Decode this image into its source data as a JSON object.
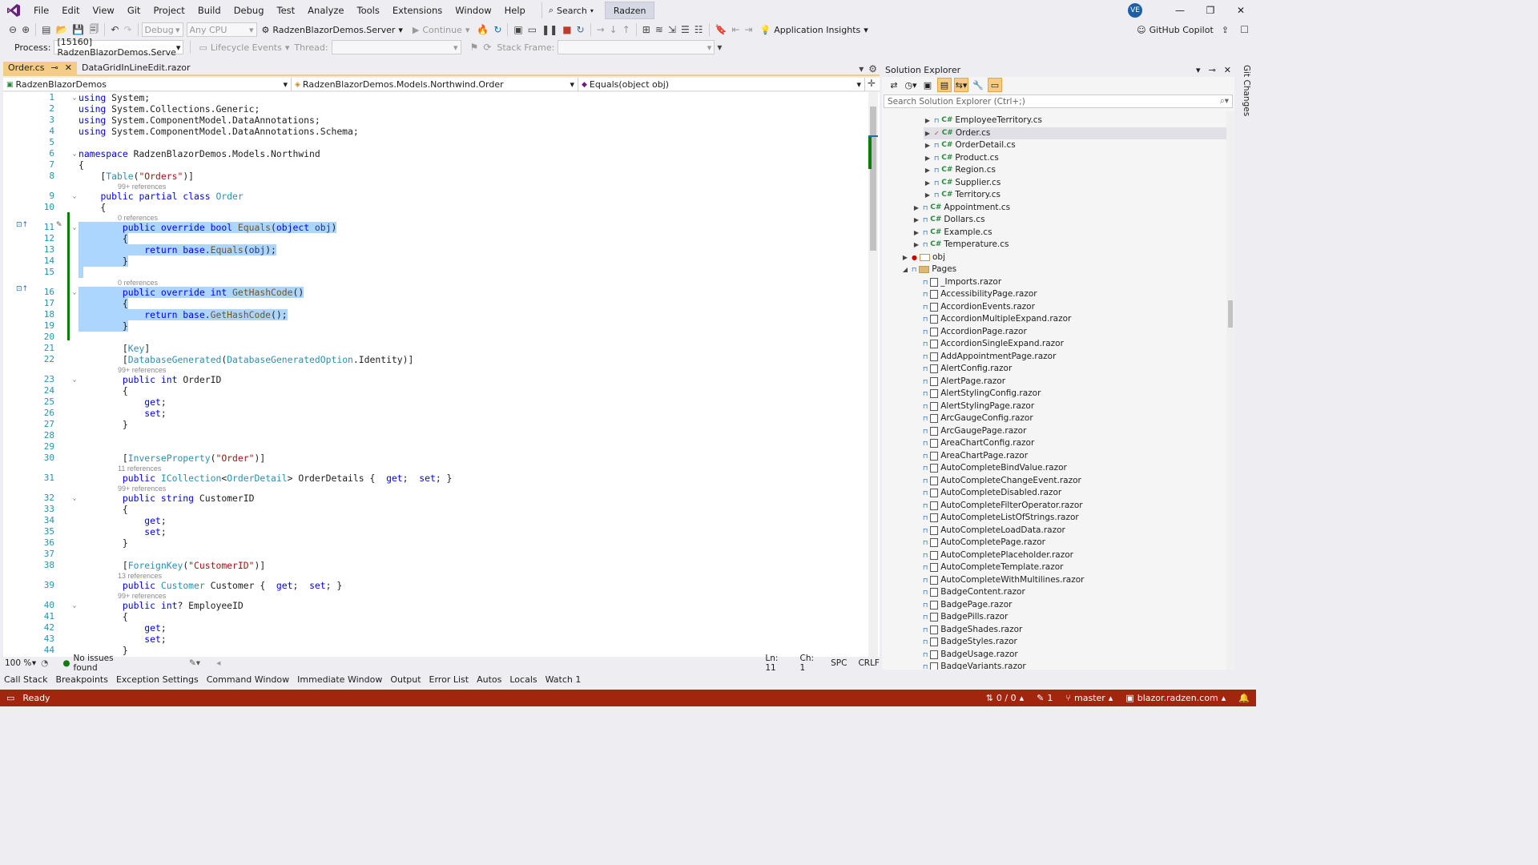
{
  "menubar": {
    "items": [
      "File",
      "Edit",
      "View",
      "Git",
      "Project",
      "Build",
      "Debug",
      "Test",
      "Analyze",
      "Tools",
      "Extensions",
      "Window",
      "Help"
    ],
    "search_label": "Search",
    "radzen_label": "Radzen",
    "avatar_initials": "VE"
  },
  "toolbar1": {
    "config": "Debug",
    "platform": "Any CPU",
    "startup_project": "RadzenBlazorDemos.Server",
    "continue_label": "Continue",
    "app_insights": "Application Insights",
    "copilot": "GitHub Copilot"
  },
  "toolbar2": {
    "process_label": "Process:",
    "process_value": "[15160] RadzenBlazorDemos.Serve",
    "lifecycle_label": "Lifecycle Events",
    "thread_label": "Thread:",
    "stackframe_label": "Stack Frame:"
  },
  "tabs": [
    "Order.cs",
    "DataGridInLineEdit.razor"
  ],
  "navbar": {
    "project": "RadzenBlazorDemos",
    "type": "RadzenBlazorDemos.Models.Northwind.Order",
    "member": "Equals(object obj)"
  },
  "editor": {
    "lines": [
      {
        "n": "1",
        "tokens": [
          [
            "kw",
            "using"
          ],
          [
            "",
            "System;"
          ]
        ]
      },
      {
        "n": "2",
        "tokens": [
          [
            "kw",
            "using"
          ],
          [
            "",
            "System.Collections.Generic;"
          ]
        ]
      },
      {
        "n": "3",
        "tokens": [
          [
            "kw",
            "using"
          ],
          [
            "",
            "System.ComponentModel.DataAnnotations;"
          ]
        ]
      },
      {
        "n": "4",
        "tokens": [
          [
            "kw",
            "using"
          ],
          [
            "",
            "System.ComponentModel.DataAnnotations.Schema;"
          ]
        ]
      },
      {
        "n": "5",
        "tokens": []
      },
      {
        "n": "6",
        "tokens": [
          [
            "kw",
            "namespace"
          ],
          [
            "",
            "RadzenBlazorDemos.Models.Northwind"
          ]
        ]
      },
      {
        "n": "7",
        "tokens": [
          [
            "",
            "{"
          ]
        ]
      },
      {
        "n": "8",
        "tokens": [
          [
            "",
            "    ["
          ],
          [
            "ty",
            "Table"
          ],
          [
            "",
            "("
          ],
          [
            "st",
            "\"Orders\""
          ],
          [
            "",
            ")]"
          ]
        ]
      },
      {
        "n": "9",
        "tokens": [
          [
            "",
            "    "
          ],
          [
            "kw",
            "public partial class"
          ],
          [
            "ty",
            "Order"
          ]
        ],
        "ref": "99+ references"
      },
      {
        "n": "10",
        "tokens": [
          [
            "",
            "    {"
          ]
        ]
      },
      {
        "n": "11",
        "tokens": [
          [
            "",
            "        "
          ],
          [
            "kw",
            "public override bool"
          ],
          [
            "mt",
            "Equals"
          ],
          [
            "",
            "("
          ],
          [
            "kw",
            "object"
          ],
          [
            "pm",
            "obj"
          ],
          [
            "",
            ")"
          ]
        ],
        "ref": "0 references",
        "sel": true
      },
      {
        "n": "12",
        "tokens": [
          [
            "",
            "        {"
          ]
        ],
        "sel": true
      },
      {
        "n": "13",
        "tokens": [
          [
            "",
            "            "
          ],
          [
            "kw",
            "return base"
          ],
          [
            "",
            "."
          ],
          [
            "mt",
            "Equals"
          ],
          [
            "",
            "("
          ],
          [
            "pm",
            "obj"
          ],
          [
            "",
            ");"
          ]
        ],
        "sel": true
      },
      {
        "n": "14",
        "tokens": [
          [
            "",
            "        }"
          ]
        ],
        "sel": true
      },
      {
        "n": "15",
        "tokens": [],
        "sel": true
      },
      {
        "n": "16",
        "tokens": [
          [
            "",
            "        "
          ],
          [
            "kw",
            "public override int"
          ],
          [
            "mt",
            "GetHashCode"
          ],
          [
            "",
            "()"
          ]
        ],
        "ref": "0 references",
        "sel": true
      },
      {
        "n": "17",
        "tokens": [
          [
            "",
            "        {"
          ]
        ],
        "sel": true
      },
      {
        "n": "18",
        "tokens": [
          [
            "",
            "            "
          ],
          [
            "kw",
            "return base"
          ],
          [
            "",
            "."
          ],
          [
            "mt",
            "GetHashCode"
          ],
          [
            "",
            "();"
          ]
        ],
        "sel": true
      },
      {
        "n": "19",
        "tokens": [
          [
            "",
            "        }"
          ]
        ],
        "sel": true
      },
      {
        "n": "20",
        "tokens": []
      },
      {
        "n": "21",
        "tokens": [
          [
            "",
            "        ["
          ],
          [
            "ty",
            "Key"
          ],
          [
            "",
            "]"
          ]
        ]
      },
      {
        "n": "22",
        "tokens": [
          [
            "",
            "        ["
          ],
          [
            "ty",
            "DatabaseGenerated"
          ],
          [
            "",
            "("
          ],
          [
            "ty",
            "DatabaseGeneratedOption"
          ],
          [
            "",
            ".Identity)]"
          ]
        ]
      },
      {
        "n": "23",
        "tokens": [
          [
            "",
            "        "
          ],
          [
            "kw",
            "public int"
          ],
          [
            "",
            "OrderID"
          ]
        ],
        "ref": "99+ references"
      },
      {
        "n": "24",
        "tokens": [
          [
            "",
            "        {"
          ]
        ]
      },
      {
        "n": "25",
        "tokens": [
          [
            "",
            "            "
          ],
          [
            "kw",
            "get"
          ],
          [
            "",
            ";"
          ]
        ]
      },
      {
        "n": "26",
        "tokens": [
          [
            "",
            "            "
          ],
          [
            "kw",
            "set"
          ],
          [
            "",
            ";"
          ]
        ]
      },
      {
        "n": "27",
        "tokens": [
          [
            "",
            "        }"
          ]
        ]
      },
      {
        "n": "28",
        "tokens": []
      },
      {
        "n": "29",
        "tokens": []
      },
      {
        "n": "30",
        "tokens": [
          [
            "",
            "        ["
          ],
          [
            "ty",
            "InverseProperty"
          ],
          [
            "",
            "("
          ],
          [
            "st",
            "\"Order\""
          ],
          [
            "",
            ")]"
          ]
        ]
      },
      {
        "n": "31",
        "tokens": [
          [
            "",
            "        "
          ],
          [
            "kw",
            "public"
          ],
          [
            "ty",
            "ICollection"
          ],
          [
            "",
            "<"
          ],
          [
            "ty",
            "OrderDetail"
          ],
          [
            "",
            "> OrderDetails { "
          ],
          [
            "kw",
            "get"
          ],
          [
            "",
            "; "
          ],
          [
            "kw",
            "set"
          ],
          [
            "",
            "; }"
          ]
        ],
        "ref": "11 references"
      },
      {
        "n": "32",
        "tokens": [
          [
            "",
            "        "
          ],
          [
            "kw",
            "public string"
          ],
          [
            "",
            "CustomerID"
          ]
        ],
        "ref": "99+ references"
      },
      {
        "n": "33",
        "tokens": [
          [
            "",
            "        {"
          ]
        ]
      },
      {
        "n": "34",
        "tokens": [
          [
            "",
            "            "
          ],
          [
            "kw",
            "get"
          ],
          [
            "",
            ";"
          ]
        ]
      },
      {
        "n": "35",
        "tokens": [
          [
            "",
            "            "
          ],
          [
            "kw",
            "set"
          ],
          [
            "",
            ";"
          ]
        ]
      },
      {
        "n": "36",
        "tokens": [
          [
            "",
            "        }"
          ]
        ]
      },
      {
        "n": "37",
        "tokens": []
      },
      {
        "n": "38",
        "tokens": [
          [
            "",
            "        ["
          ],
          [
            "ty",
            "ForeignKey"
          ],
          [
            "",
            "("
          ],
          [
            "st",
            "\"CustomerID\""
          ],
          [
            "",
            ")]"
          ]
        ]
      },
      {
        "n": "39",
        "tokens": [
          [
            "",
            "        "
          ],
          [
            "kw",
            "public"
          ],
          [
            "ty",
            "Customer"
          ],
          [
            "",
            "Customer { "
          ],
          [
            "kw",
            "get"
          ],
          [
            "",
            "; "
          ],
          [
            "kw",
            "set"
          ],
          [
            "",
            "; }"
          ]
        ],
        "ref": "13 references"
      },
      {
        "n": "40",
        "tokens": [
          [
            "",
            "        "
          ],
          [
            "kw",
            "public int"
          ],
          [
            "",
            "? EmployeeID"
          ]
        ],
        "ref": "99+ references"
      },
      {
        "n": "41",
        "tokens": [
          [
            "",
            "        {"
          ]
        ]
      },
      {
        "n": "42",
        "tokens": [
          [
            "",
            "            "
          ],
          [
            "kw",
            "get"
          ],
          [
            "",
            ";"
          ]
        ]
      },
      {
        "n": "43",
        "tokens": [
          [
            "",
            "            "
          ],
          [
            "kw",
            "set"
          ],
          [
            "",
            ";"
          ]
        ]
      },
      {
        "n": "44",
        "tokens": [
          [
            "",
            "        }"
          ]
        ]
      },
      {
        "n": "45",
        "tokens": []
      }
    ]
  },
  "editor_status": {
    "zoom": "100 %",
    "issues": "No issues found",
    "ln": "Ln: 11",
    "ch": "Ch: 1",
    "spc": "SPC",
    "crlf": "CRLF"
  },
  "solution_explorer": {
    "title": "Solution Explorer",
    "search_placeholder": "Search Solution Explorer (Ctrl+;)",
    "items": [
      {
        "label": "EmployeeTerritory.cs",
        "indent": 3,
        "kind": "cs",
        "exp": "▶"
      },
      {
        "label": "Order.cs",
        "indent": 3,
        "kind": "cs",
        "exp": "▶",
        "selected": true
      },
      {
        "label": "OrderDetail.cs",
        "indent": 3,
        "kind": "cs",
        "exp": "▶"
      },
      {
        "label": "Product.cs",
        "indent": 3,
        "kind": "cs",
        "exp": "▶"
      },
      {
        "label": "Region.cs",
        "indent": 3,
        "kind": "cs",
        "exp": "▶"
      },
      {
        "label": "Supplier.cs",
        "indent": 3,
        "kind": "cs",
        "exp": "▶"
      },
      {
        "label": "Territory.cs",
        "indent": 3,
        "kind": "cs",
        "exp": "▶"
      },
      {
        "label": "Appointment.cs",
        "indent": 2,
        "kind": "cs",
        "exp": "▶"
      },
      {
        "label": "Dollars.cs",
        "indent": 2,
        "kind": "cs",
        "exp": "▶"
      },
      {
        "label": "Example.cs",
        "indent": 2,
        "kind": "cs",
        "exp": "▶"
      },
      {
        "label": "Temperature.cs",
        "indent": 2,
        "kind": "cs",
        "exp": "▶"
      },
      {
        "label": "obj",
        "indent": 1,
        "kind": "folder-excluded",
        "exp": "▶"
      },
      {
        "label": "Pages",
        "indent": 1,
        "kind": "folder",
        "exp": "◢"
      },
      {
        "label": "_Imports.razor",
        "indent": 2,
        "kind": "razor",
        "exp": ""
      },
      {
        "label": "AccessibilityPage.razor",
        "indent": 2,
        "kind": "razor",
        "exp": ""
      },
      {
        "label": "AccordionEvents.razor",
        "indent": 2,
        "kind": "razor",
        "exp": ""
      },
      {
        "label": "AccordionMultipleExpand.razor",
        "indent": 2,
        "kind": "razor",
        "exp": ""
      },
      {
        "label": "AccordionPage.razor",
        "indent": 2,
        "kind": "razor",
        "exp": ""
      },
      {
        "label": "AccordionSingleExpand.razor",
        "indent": 2,
        "kind": "razor",
        "exp": ""
      },
      {
        "label": "AddAppointmentPage.razor",
        "indent": 2,
        "kind": "razor",
        "exp": ""
      },
      {
        "label": "AlertConfig.razor",
        "indent": 2,
        "kind": "razor",
        "exp": ""
      },
      {
        "label": "AlertPage.razor",
        "indent": 2,
        "kind": "razor",
        "exp": ""
      },
      {
        "label": "AlertStylingConfig.razor",
        "indent": 2,
        "kind": "razor",
        "exp": ""
      },
      {
        "label": "AlertStylingPage.razor",
        "indent": 2,
        "kind": "razor",
        "exp": ""
      },
      {
        "label": "ArcGaugeConfig.razor",
        "indent": 2,
        "kind": "razor",
        "exp": ""
      },
      {
        "label": "ArcGaugePage.razor",
        "indent": 2,
        "kind": "razor",
        "exp": ""
      },
      {
        "label": "AreaChartConfig.razor",
        "indent": 2,
        "kind": "razor",
        "exp": ""
      },
      {
        "label": "AreaChartPage.razor",
        "indent": 2,
        "kind": "razor",
        "exp": ""
      },
      {
        "label": "AutoCompleteBindValue.razor",
        "indent": 2,
        "kind": "razor",
        "exp": ""
      },
      {
        "label": "AutoCompleteChangeEvent.razor",
        "indent": 2,
        "kind": "razor",
        "exp": ""
      },
      {
        "label": "AutoCompleteDisabled.razor",
        "indent": 2,
        "kind": "razor",
        "exp": ""
      },
      {
        "label": "AutoCompleteFilterOperator.razor",
        "indent": 2,
        "kind": "razor",
        "exp": ""
      },
      {
        "label": "AutoCompleteListOfStrings.razor",
        "indent": 2,
        "kind": "razor",
        "exp": ""
      },
      {
        "label": "AutoCompleteLoadData.razor",
        "indent": 2,
        "kind": "razor",
        "exp": ""
      },
      {
        "label": "AutoCompletePage.razor",
        "indent": 2,
        "kind": "razor",
        "exp": ""
      },
      {
        "label": "AutoCompletePlaceholder.razor",
        "indent": 2,
        "kind": "razor",
        "exp": ""
      },
      {
        "label": "AutoCompleteTemplate.razor",
        "indent": 2,
        "kind": "razor",
        "exp": ""
      },
      {
        "label": "AutoCompleteWithMultilines.razor",
        "indent": 2,
        "kind": "razor",
        "exp": ""
      },
      {
        "label": "BadgeContent.razor",
        "indent": 2,
        "kind": "razor",
        "exp": ""
      },
      {
        "label": "BadgePage.razor",
        "indent": 2,
        "kind": "razor",
        "exp": ""
      },
      {
        "label": "BadgePills.razor",
        "indent": 2,
        "kind": "razor",
        "exp": ""
      },
      {
        "label": "BadgeShades.razor",
        "indent": 2,
        "kind": "razor",
        "exp": ""
      },
      {
        "label": "BadgeStyles.razor",
        "indent": 2,
        "kind": "razor",
        "exp": ""
      },
      {
        "label": "BadgeUsage.razor",
        "indent": 2,
        "kind": "razor",
        "exp": ""
      },
      {
        "label": "BadgeVariants.razor",
        "indent": 2,
        "kind": "razor",
        "exp": ""
      }
    ]
  },
  "git_changes_label": "Git Changes",
  "bottom_tabs": [
    "Call Stack",
    "Breakpoints",
    "Exception Settings",
    "Command Window",
    "Immediate Window",
    "Output",
    "Error List",
    "Autos",
    "Locals",
    "Watch 1"
  ],
  "statusbar": {
    "ready": "Ready",
    "sync": "0 / 0",
    "pending": "1",
    "branch": "master",
    "repo": "blazor.radzen.com"
  },
  "colors": {
    "status_bg": "#a1260d",
    "tab_active": "#f5cc84",
    "selection": "#add6ff",
    "vs_purple": "#68217a"
  }
}
